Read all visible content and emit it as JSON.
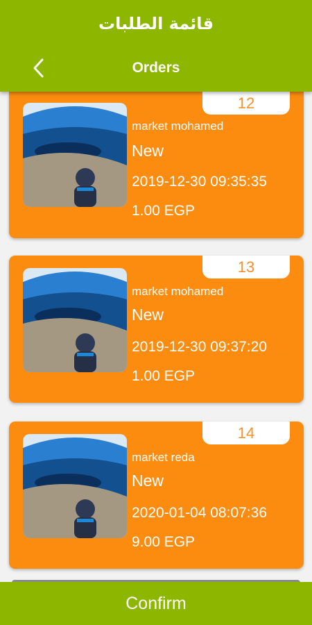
{
  "header": {
    "arabic_title": "قائمة الطلبات",
    "title": "Orders",
    "back_icon": "chevron-left-icon"
  },
  "orders": [
    {
      "number": "12",
      "market": "market  mohamed",
      "status": "New",
      "date": "2019-12-30 09:35:35",
      "price": "1.00 EGP"
    },
    {
      "number": "13",
      "market": "market  mohamed",
      "status": "New",
      "date": "2019-12-30 09:37:20",
      "price": "1.00 EGP"
    },
    {
      "number": "14",
      "market": "market reda",
      "status": "New",
      "date": "2020-01-04 08:07:36",
      "price": "9.00 EGP"
    }
  ],
  "footer": {
    "confirm_label": "Confirm"
  },
  "colors": {
    "accent": "#8db600",
    "card": "#fb8c10",
    "number": "#f7902a"
  }
}
